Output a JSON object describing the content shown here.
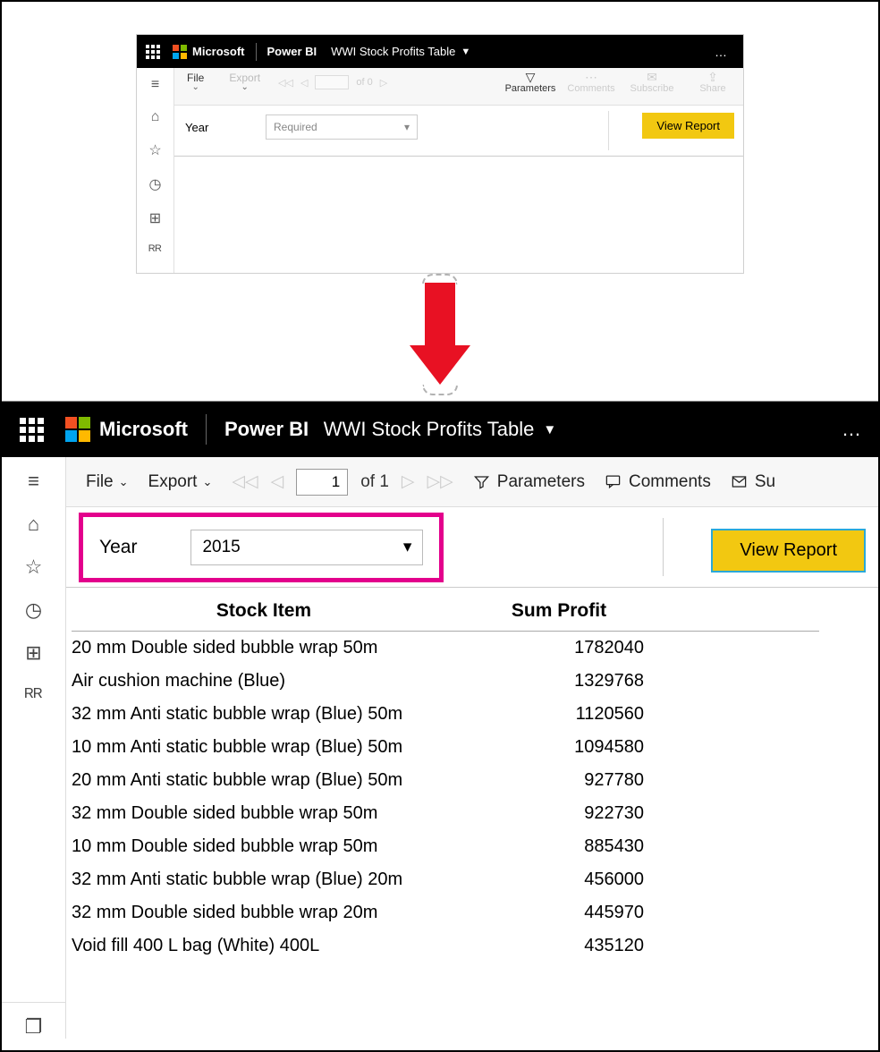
{
  "brand": {
    "company": "Microsoft",
    "product": "Power BI"
  },
  "report_title": "WWI Stock Profits Table",
  "more": "…",
  "small": {
    "toolbar": {
      "file": "File",
      "export": "Export",
      "page_of": "of 0",
      "parameters": "Parameters",
      "comments": "Comments",
      "subscribe": "Subscribe",
      "share": "Share"
    },
    "param": {
      "label": "Year",
      "placeholder": "Required"
    },
    "view_report": "View Report"
  },
  "large": {
    "toolbar": {
      "file": "File",
      "export": "Export",
      "page_value": "1",
      "page_of": "of 1",
      "parameters": "Parameters",
      "comments": "Comments",
      "subscribe_partial": "Su"
    },
    "param": {
      "label": "Year",
      "value": "2015"
    },
    "view_report": "View Report",
    "table": {
      "headers": {
        "col1": "Stock Item",
        "col2": "Sum Profit"
      },
      "rows": [
        {
          "item": "20 mm Double sided bubble wrap 50m",
          "profit": "1782040"
        },
        {
          "item": "Air cushion machine (Blue)",
          "profit": "1329768"
        },
        {
          "item": "32 mm Anti static bubble wrap (Blue) 50m",
          "profit": "1120560"
        },
        {
          "item": "10 mm Anti static bubble wrap (Blue) 50m",
          "profit": "1094580"
        },
        {
          "item": "20 mm Anti static bubble wrap (Blue) 50m",
          "profit": "927780"
        },
        {
          "item": "32 mm Double sided bubble wrap 50m",
          "profit": "922730"
        },
        {
          "item": "10 mm Double sided bubble wrap 50m",
          "profit": "885430"
        },
        {
          "item": "32 mm Anti static bubble wrap (Blue) 20m",
          "profit": "456000"
        },
        {
          "item": "32 mm Double sided bubble wrap 20m",
          "profit": "445970"
        },
        {
          "item": "Void fill 400 L bag (White) 400L",
          "profit": "435120"
        }
      ]
    }
  }
}
